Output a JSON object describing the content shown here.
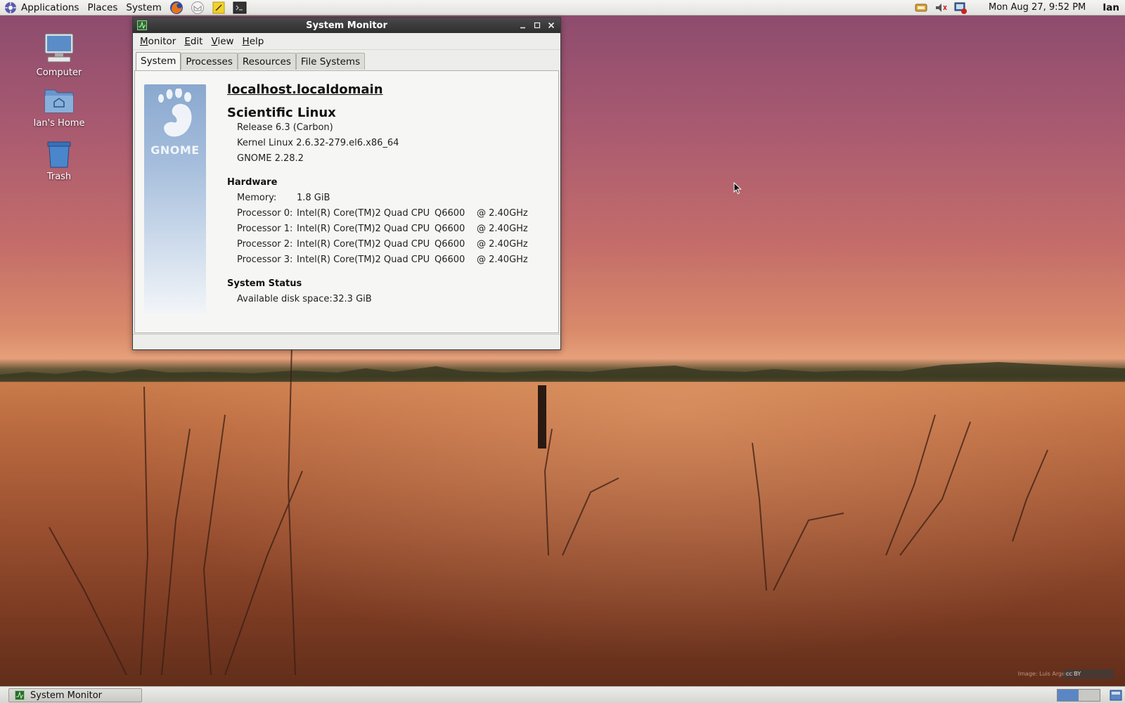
{
  "top_panel": {
    "menus": [
      "Applications",
      "Places",
      "System"
    ],
    "launchers": [
      "firefox-icon",
      "mail-icon",
      "notes-icon",
      "terminal-icon"
    ],
    "tray_icons": [
      "network-icon",
      "volume-icon",
      "update-icon"
    ],
    "clock": "Mon Aug 27,  9:52 PM",
    "user": "Ian"
  },
  "desktop": {
    "icons": [
      {
        "name": "computer-icon",
        "label": "Computer"
      },
      {
        "name": "home-folder-icon",
        "label": "Ian's Home"
      },
      {
        "name": "trash-icon",
        "label": "Trash"
      }
    ]
  },
  "window": {
    "title": "System Monitor",
    "menus": [
      {
        "label": "Monitor",
        "mnemonic": "M"
      },
      {
        "label": "Edit",
        "mnemonic": "E"
      },
      {
        "label": "View",
        "mnemonic": "V"
      },
      {
        "label": "Help",
        "mnemonic": "H"
      }
    ],
    "tabs": [
      "System",
      "Processes",
      "Resources",
      "File Systems"
    ],
    "active_tab": "System",
    "logo_text": "GNOME",
    "system": {
      "hostname": "localhost.localdomain",
      "distro": "Scientific Linux",
      "release": "Release 6.3 (Carbon)",
      "kernel": "Kernel Linux 2.6.32-279.el6.x86_64",
      "gnome": "GNOME 2.28.2"
    },
    "hardware": {
      "heading": "Hardware",
      "memory_label": "Memory:",
      "memory_value": "1.8 GiB",
      "processors": [
        {
          "label": "Processor 0:",
          "model": "Intel(R) Core(TM)2 Quad CPU",
          "id": "Q6600",
          "speed": "@ 2.40GHz"
        },
        {
          "label": "Processor 1:",
          "model": "Intel(R) Core(TM)2 Quad CPU",
          "id": "Q6600",
          "speed": "@ 2.40GHz"
        },
        {
          "label": "Processor 2:",
          "model": "Intel(R) Core(TM)2 Quad CPU",
          "id": "Q6600",
          "speed": "@ 2.40GHz"
        },
        {
          "label": "Processor 3:",
          "model": "Intel(R) Core(TM)2 Quad CPU",
          "id": "Q6600",
          "speed": "@ 2.40GHz"
        }
      ]
    },
    "status": {
      "heading": "System Status",
      "disk_label": "Available disk space:",
      "disk_value": "32.3 GiB"
    }
  },
  "bottom_panel": {
    "task": "System Monitor",
    "workspaces": 2,
    "active_workspace": 1
  },
  "wallpaper_credit": "Image: Luis Argerich",
  "cc_badge": "cc BY",
  "colors": {
    "title_bar": "#2e2e2e",
    "gnome_logo_blue": "#8aa8cf",
    "workspace_active": "#5b86c4"
  }
}
